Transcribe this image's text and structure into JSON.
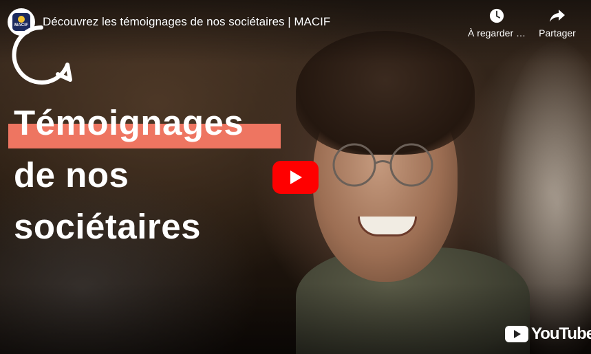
{
  "video": {
    "title": "Découvrez les témoignages de nos sociétaires | MACIF"
  },
  "channel": {
    "logo_text": "MACIF",
    "logo_colors": {
      "background": "#1c2a5e",
      "sun": "#f2c12e"
    }
  },
  "actions": {
    "watch_later_label": "À regarder …",
    "share_label": "Partager"
  },
  "overlay": {
    "line1": "Témoignages",
    "line2": "de nos",
    "line3": "sociétaires",
    "accent_color": "#ee7561"
  },
  "branding": {
    "youtube_wordmark": "YouTube",
    "play_color": "#ff0000"
  },
  "icons": [
    "clock-icon",
    "share-arrow-icon",
    "play-icon",
    "youtube-logo-icon",
    "speech-bubble-icon"
  ]
}
